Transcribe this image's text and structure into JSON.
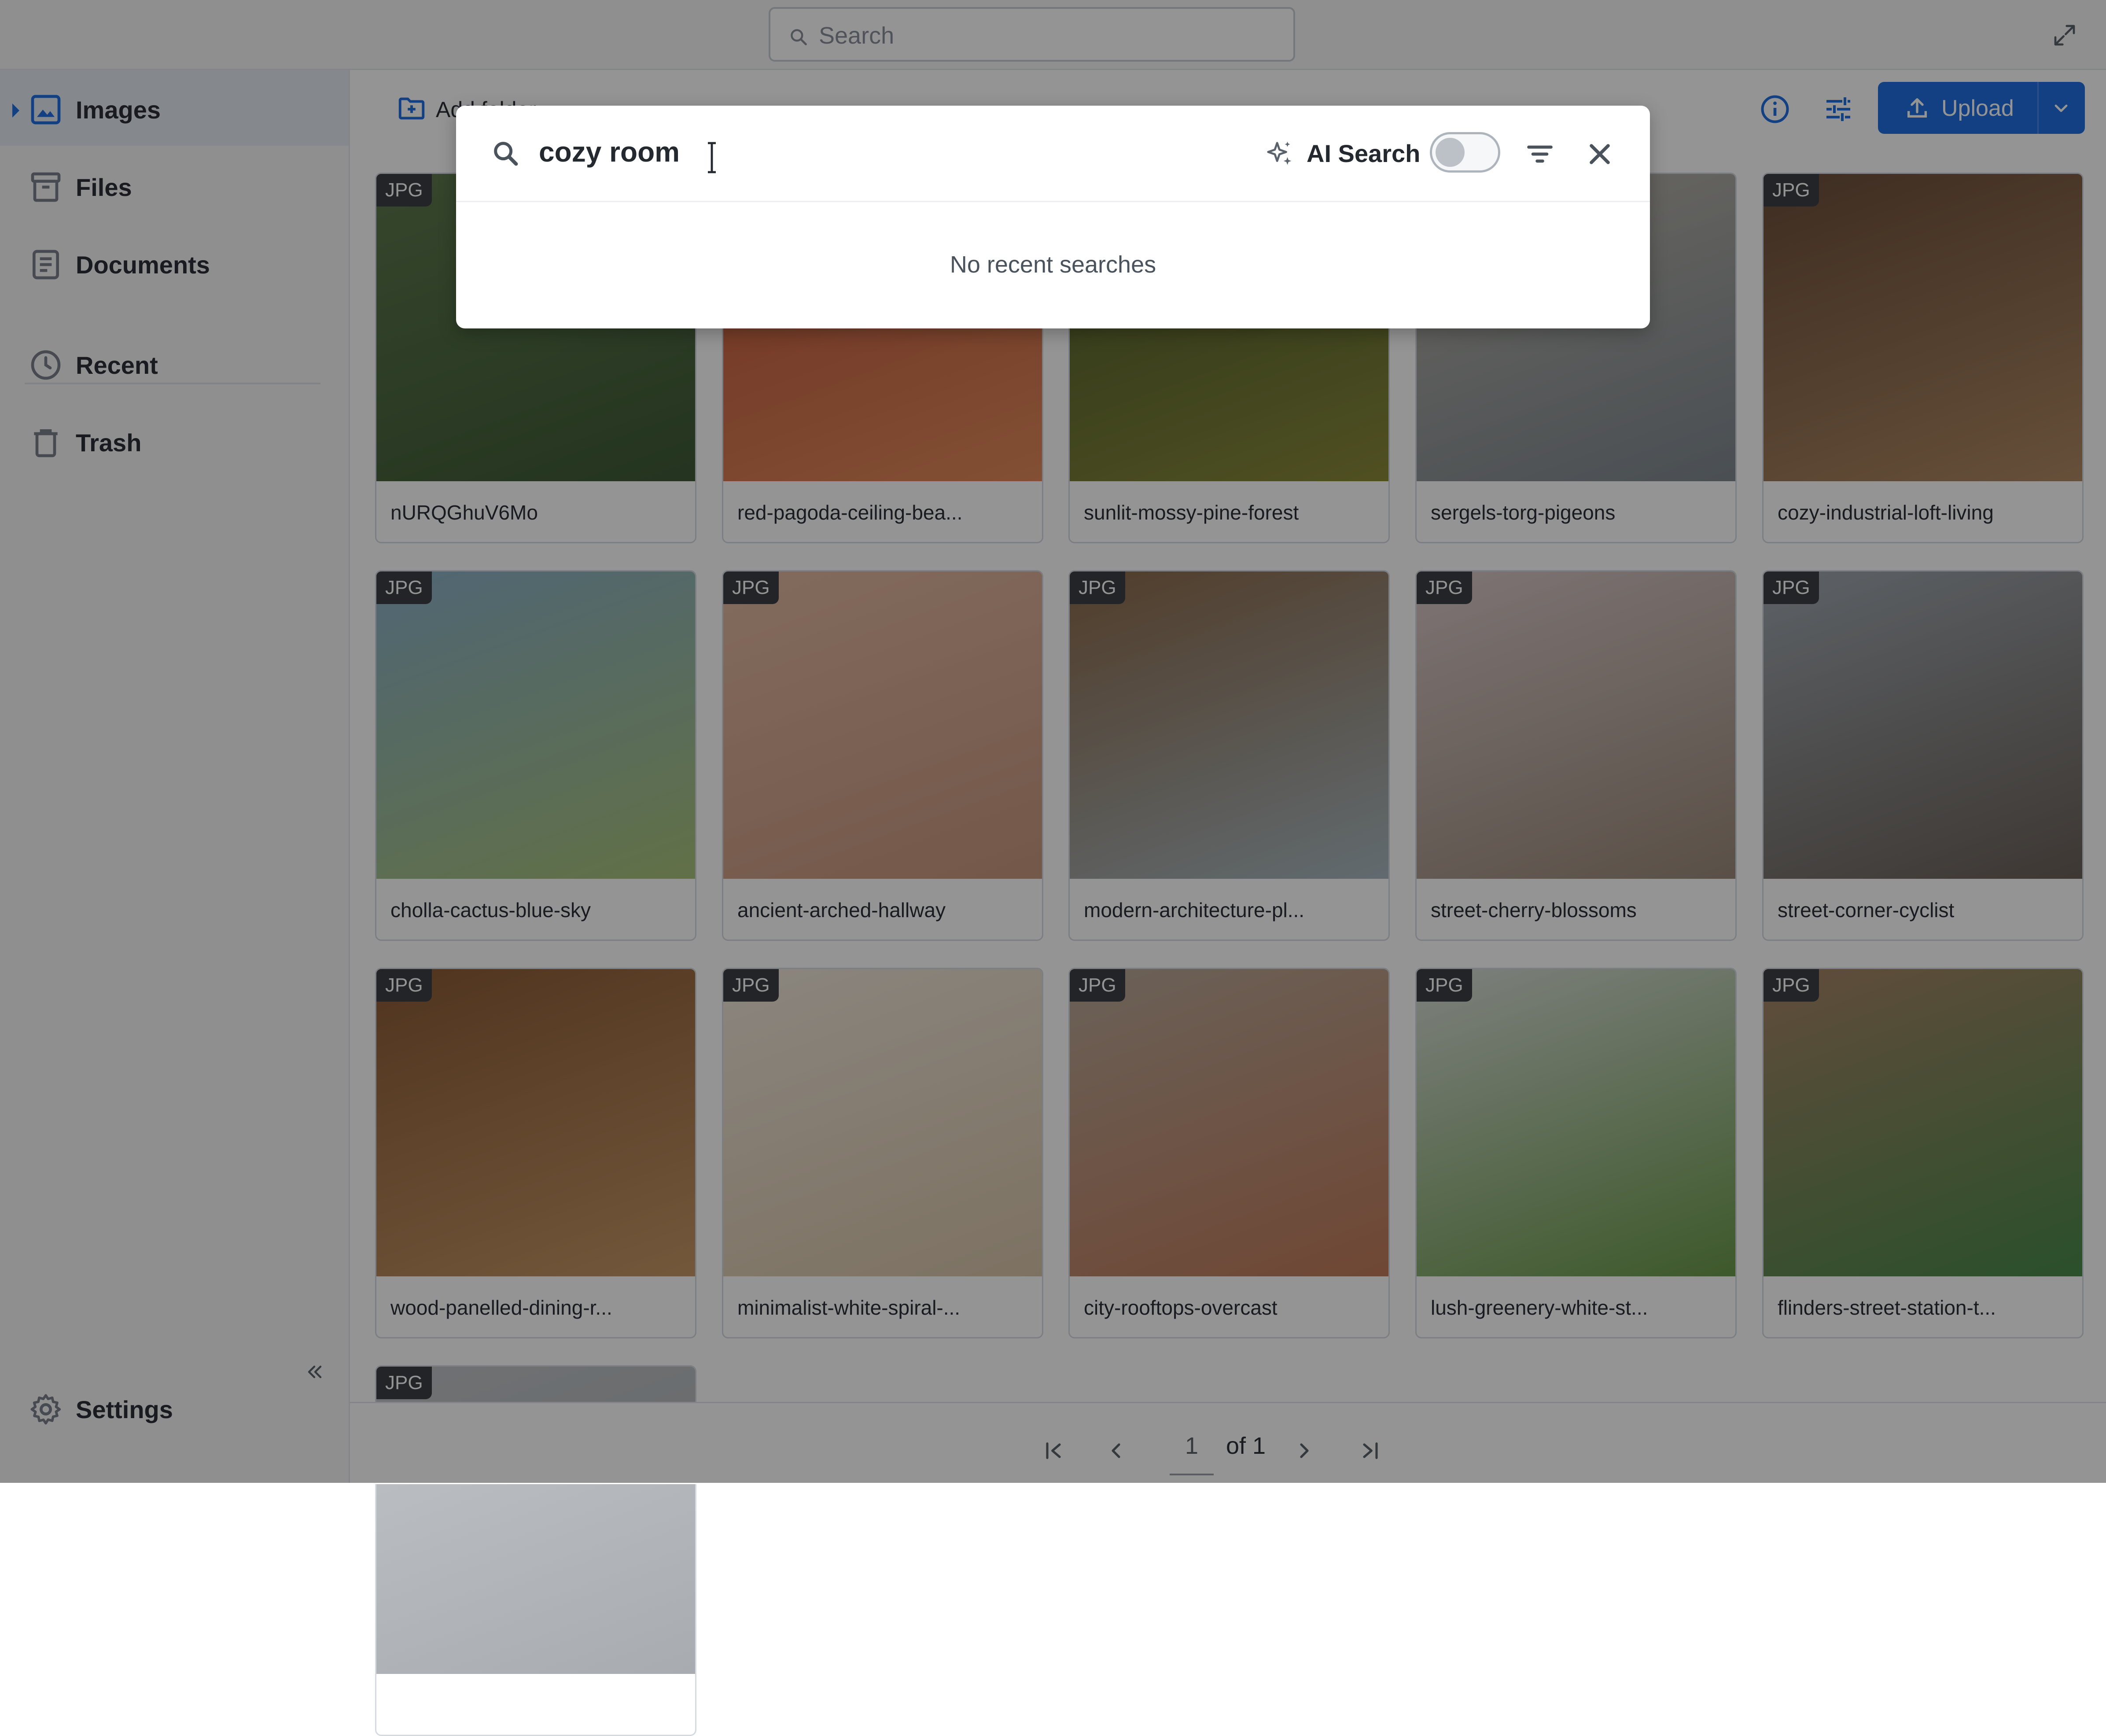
{
  "topbar": {
    "search_placeholder": "Search"
  },
  "sidebar": {
    "items": [
      {
        "label": "Images",
        "icon": "image-icon",
        "active": true
      },
      {
        "label": "Files",
        "icon": "archive-icon",
        "active": false
      },
      {
        "label": "Documents",
        "icon": "document-icon",
        "active": false
      },
      {
        "label": "Recent",
        "icon": "clock-icon",
        "active": false
      },
      {
        "label": "Trash",
        "icon": "trash-icon",
        "active": false
      }
    ],
    "settings_label": "Settings"
  },
  "toolbar": {
    "add_folder_label": "Add folder",
    "upload_label": "Upload"
  },
  "grid": {
    "badge": "JPG",
    "items": [
      {
        "name": "nURQGhuV6Mo"
      },
      {
        "name": "red-pagoda-ceiling-bea..."
      },
      {
        "name": "sunlit-mossy-pine-forest"
      },
      {
        "name": "sergels-torg-pigeons"
      },
      {
        "name": "cozy-industrial-loft-living"
      },
      {
        "name": "cholla-cactus-blue-sky"
      },
      {
        "name": "ancient-arched-hallway"
      },
      {
        "name": "modern-architecture-pl..."
      },
      {
        "name": "street-cherry-blossoms"
      },
      {
        "name": "street-corner-cyclist"
      },
      {
        "name": "wood-panelled-dining-r..."
      },
      {
        "name": "minimalist-white-spiral-..."
      },
      {
        "name": "city-rooftops-overcast"
      },
      {
        "name": "lush-greenery-white-st..."
      },
      {
        "name": "flinders-street-station-t..."
      },
      {
        "name": ""
      }
    ]
  },
  "pagination": {
    "current_page": "1",
    "of_label": "of 1"
  },
  "search_modal": {
    "query": "cozy room",
    "ai_search_label": "AI Search",
    "ai_search_enabled": false,
    "empty_message": "No recent searches"
  },
  "colors": {
    "accent": "#1f6fe0",
    "badge_bg": "#3b3f45",
    "overlay": "rgba(0,0,0,0.42)"
  }
}
